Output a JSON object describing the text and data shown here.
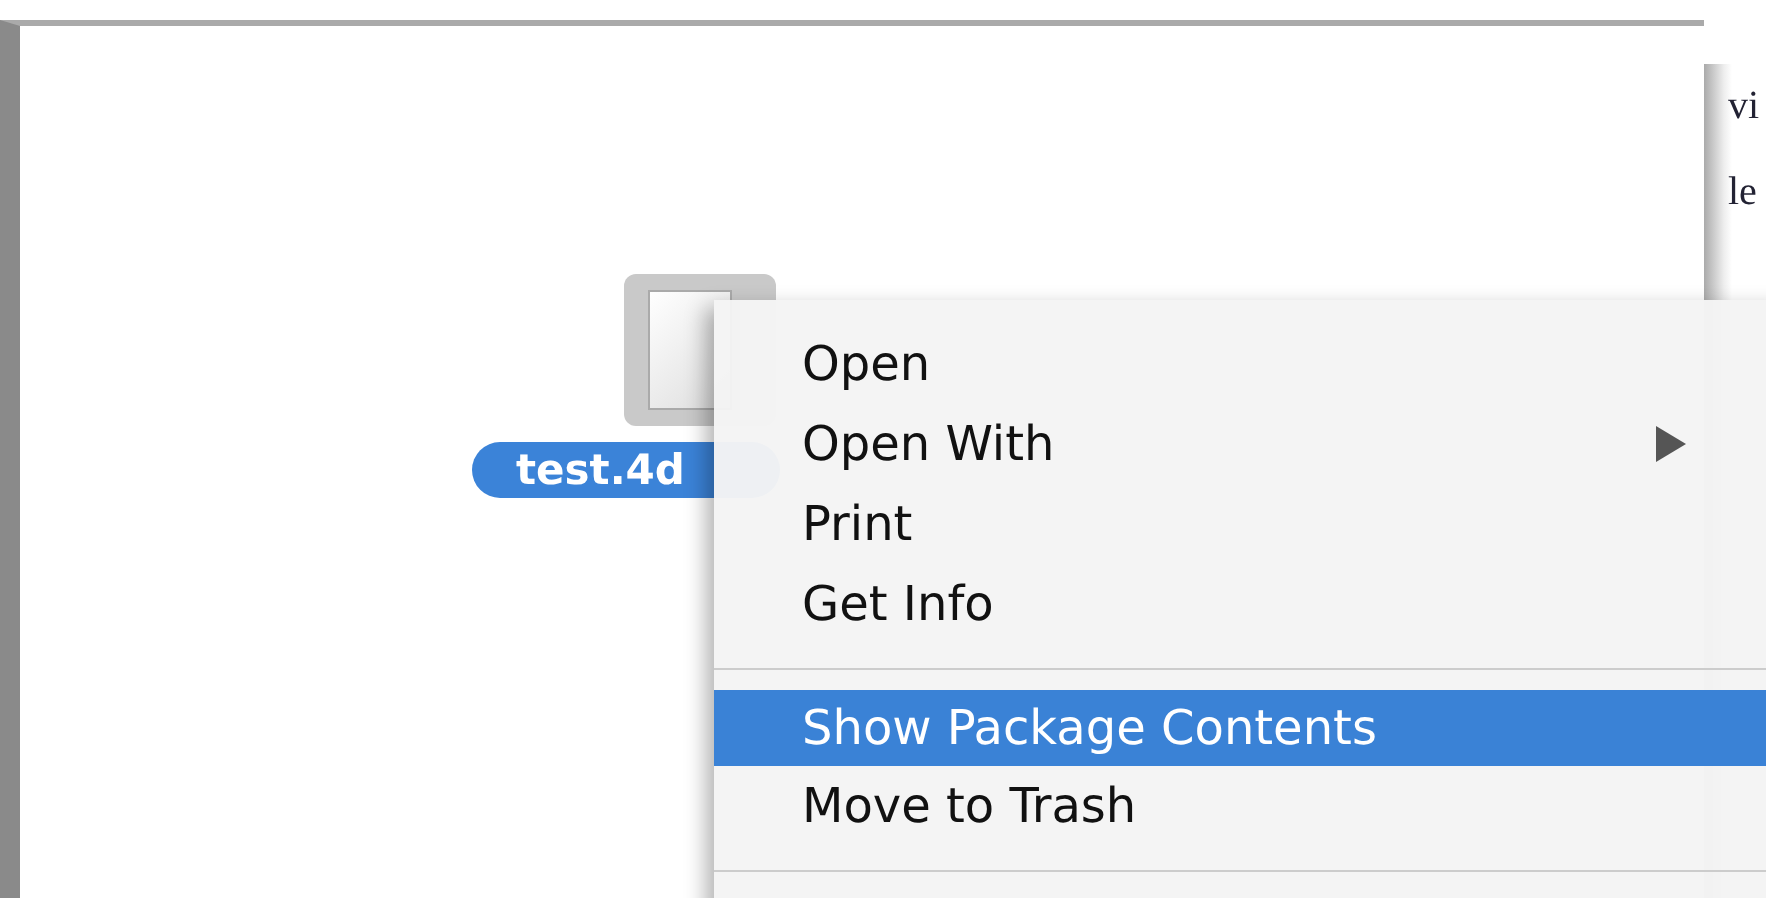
{
  "background_window": {
    "texts": [
      "vi",
      "le"
    ]
  },
  "file": {
    "name": "test.4d",
    "selected": true
  },
  "context_menu": {
    "items": [
      {
        "kind": "item",
        "label": "Open",
        "selected": false,
        "submenu": false
      },
      {
        "kind": "item",
        "label": "Open With",
        "selected": false,
        "submenu": true
      },
      {
        "kind": "item",
        "label": "Print",
        "selected": false,
        "submenu": false
      },
      {
        "kind": "item",
        "label": "Get Info",
        "selected": false,
        "submenu": false
      },
      {
        "kind": "separator"
      },
      {
        "kind": "item",
        "label": "Show Package Contents",
        "selected": true,
        "submenu": false
      },
      {
        "kind": "item",
        "label": "Move to Trash",
        "selected": false,
        "submenu": false
      },
      {
        "kind": "separator"
      }
    ]
  }
}
